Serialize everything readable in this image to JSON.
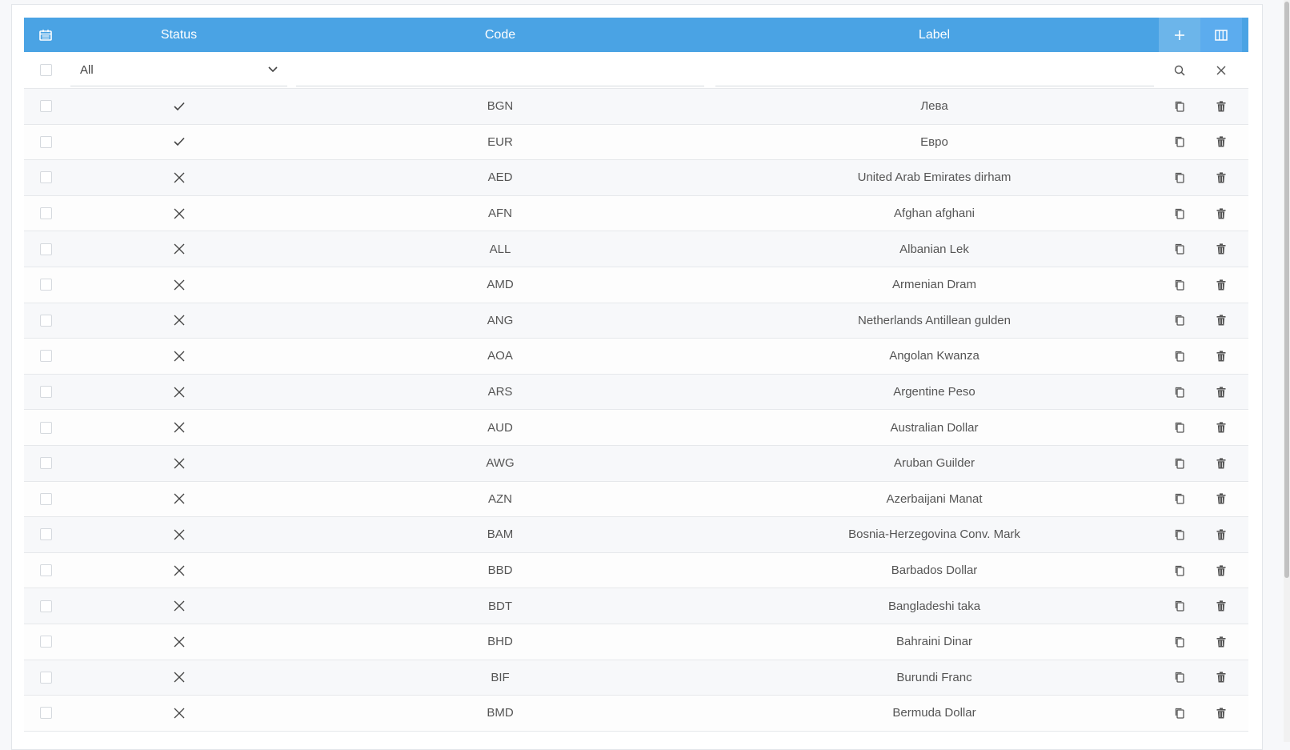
{
  "header": {
    "status": "Status",
    "code": "Code",
    "label": "Label"
  },
  "filter": {
    "status_selected": "All",
    "code_value": "",
    "label_value": ""
  },
  "rows": [
    {
      "active": true,
      "code": "BGN",
      "label": "Лева"
    },
    {
      "active": true,
      "code": "EUR",
      "label": "Евро"
    },
    {
      "active": false,
      "code": "AED",
      "label": "United Arab Emirates dirham"
    },
    {
      "active": false,
      "code": "AFN",
      "label": "Afghan afghani"
    },
    {
      "active": false,
      "code": "ALL",
      "label": "Albanian Lek"
    },
    {
      "active": false,
      "code": "AMD",
      "label": "Armenian Dram"
    },
    {
      "active": false,
      "code": "ANG",
      "label": "Netherlands Antillean gulden"
    },
    {
      "active": false,
      "code": "AOA",
      "label": "Angolan Kwanza"
    },
    {
      "active": false,
      "code": "ARS",
      "label": "Argentine Peso"
    },
    {
      "active": false,
      "code": "AUD",
      "label": "Australian Dollar"
    },
    {
      "active": false,
      "code": "AWG",
      "label": "Aruban Guilder"
    },
    {
      "active": false,
      "code": "AZN",
      "label": "Azerbaijani Manat"
    },
    {
      "active": false,
      "code": "BAM",
      "label": "Bosnia-Herzegovina Conv. Mark"
    },
    {
      "active": false,
      "code": "BBD",
      "label": "Barbados Dollar"
    },
    {
      "active": false,
      "code": "BDT",
      "label": "Bangladeshi taka"
    },
    {
      "active": false,
      "code": "BHD",
      "label": "Bahraini Dinar"
    },
    {
      "active": false,
      "code": "BIF",
      "label": "Burundi Franc"
    },
    {
      "active": false,
      "code": "BMD",
      "label": "Bermuda Dollar"
    }
  ],
  "colors": {
    "header_bg": "#4aa3e4",
    "header_text": "#ffffff"
  }
}
